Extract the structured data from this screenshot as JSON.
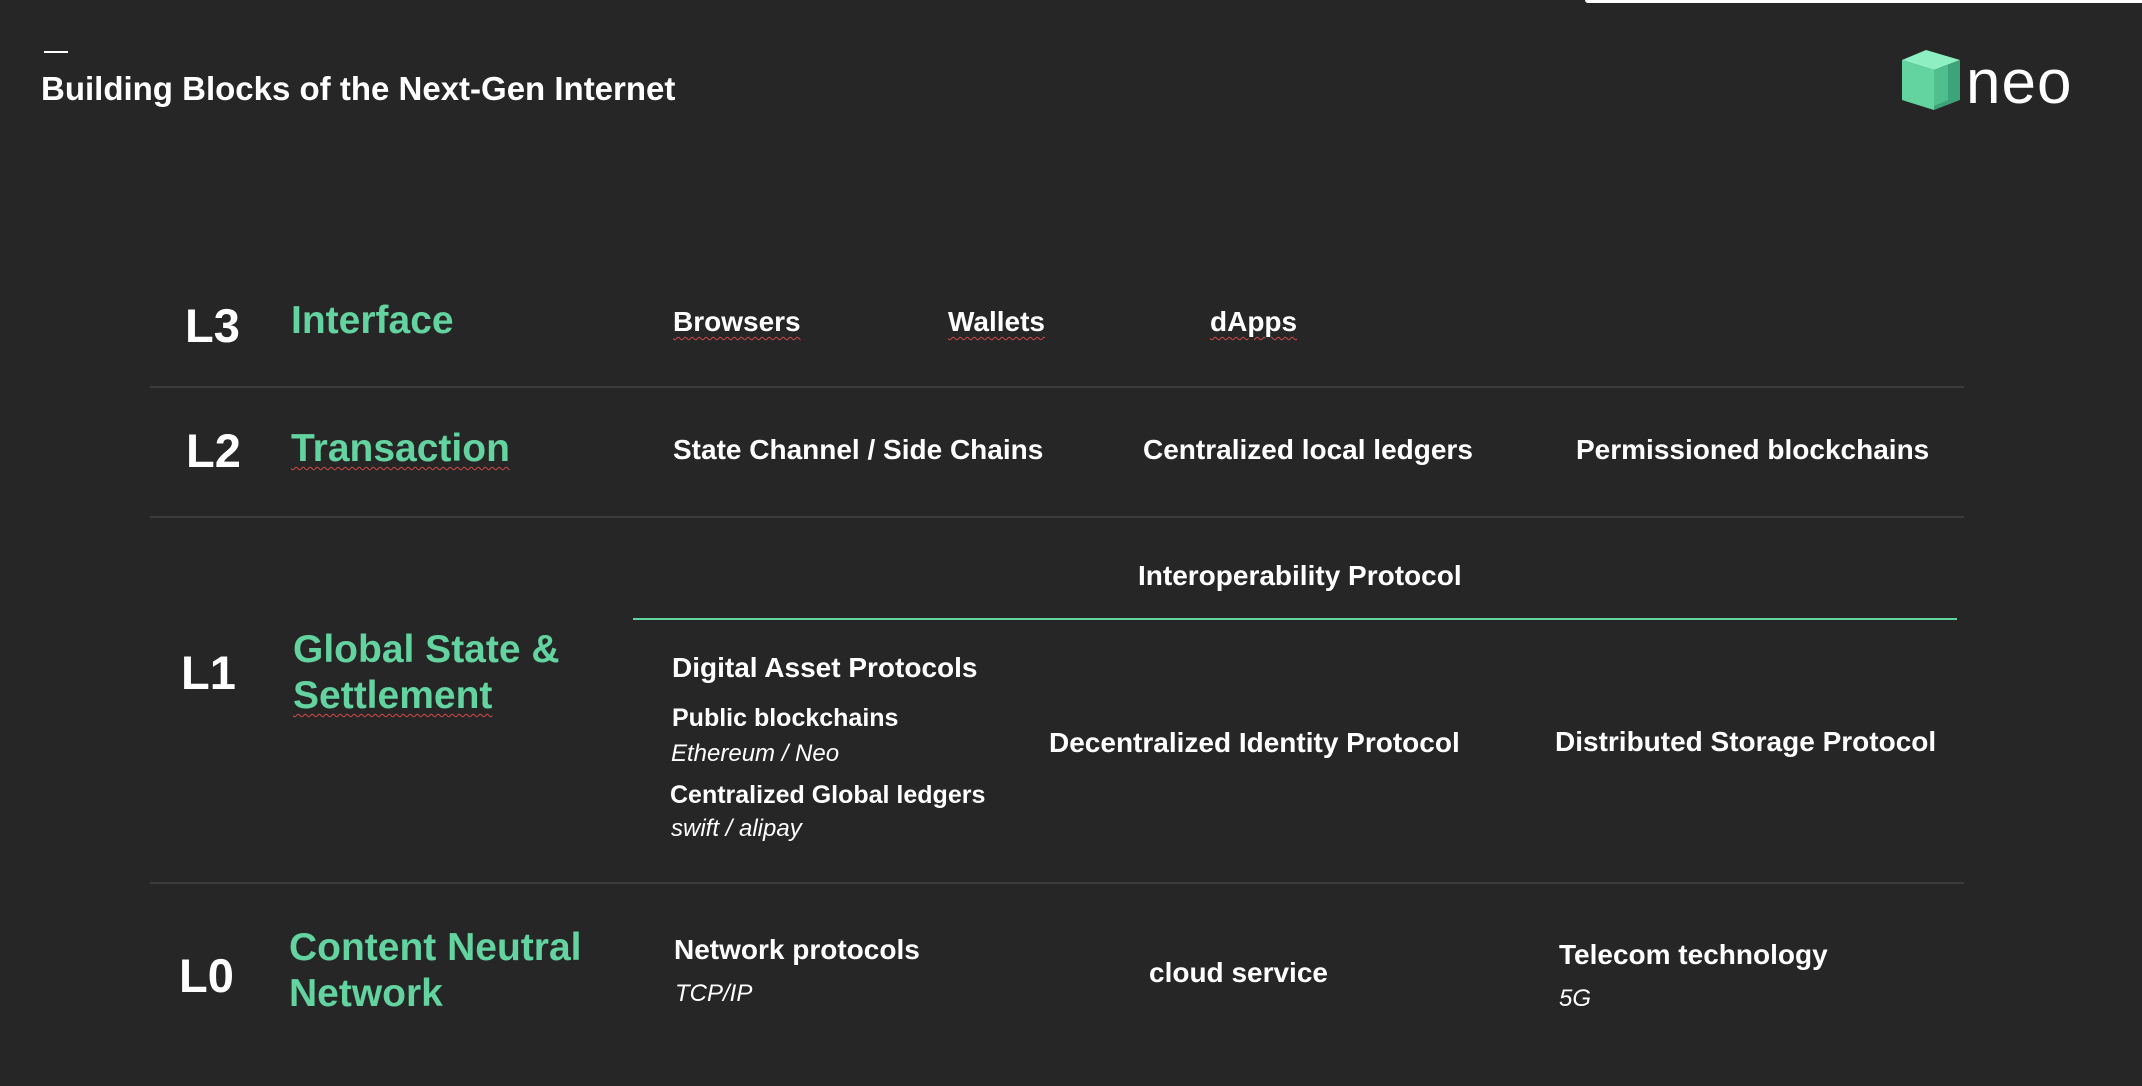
{
  "header": {
    "title": "Building Blocks of the Next-Gen Internet",
    "logo_text": "neo",
    "logo_icon": "neo-cube-icon",
    "accent_color": "#63d3a0",
    "background_color": "#262626"
  },
  "layers": {
    "l3": {
      "id": "L3",
      "category": "Interface",
      "items": [
        "Browsers",
        "Wallets",
        "dApps"
      ]
    },
    "l2": {
      "id": "L2",
      "category": "Transaction",
      "items": [
        "State Channel / Side Chains",
        "Centralized local ledgers",
        "Permissioned blockchains"
      ]
    },
    "l1": {
      "id": "L1",
      "category_line1": "Global State &",
      "category_line2": "Settlement",
      "interop": "Interoperability Protocol",
      "digital_asset": {
        "heading": "Digital Asset Protocols",
        "public_label": "Public blockchains",
        "public_examples": "Ethereum / Neo",
        "centralized_label": "Centralized Global ledgers",
        "centralized_examples": "swift / alipay"
      },
      "identity": "Decentralized Identity Protocol",
      "storage": "Distributed Storage Protocol"
    },
    "l0": {
      "id": "L0",
      "category_line1": "Content Neutral",
      "category_line2": "Network",
      "network": "Network protocols",
      "network_example": "TCP/IP",
      "cloud": "cloud service",
      "telecom": "Telecom technology",
      "telecom_example": "5G"
    }
  }
}
